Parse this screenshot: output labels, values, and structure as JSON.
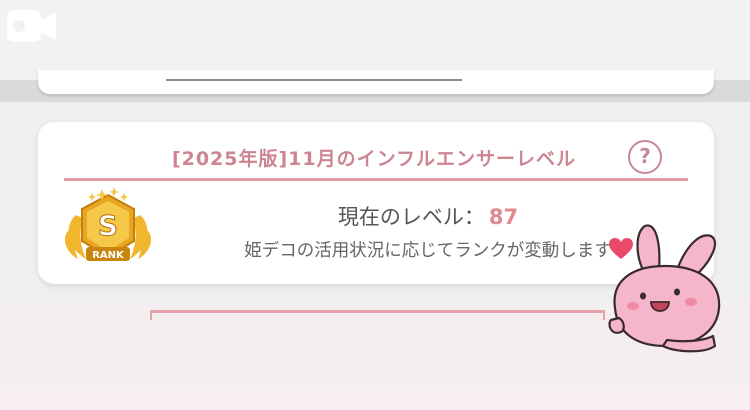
{
  "status_bar": {
    "record_icon": "video-camera-icon"
  },
  "influencer_card": {
    "title": "[2025年版]11月のインフルエンサーレベル",
    "help_symbol": "?",
    "rank_badge": {
      "letter": "S",
      "label": "RANK",
      "color": "#e8a520"
    },
    "level_label": "現在のレベル：",
    "level_value": "87",
    "description": "姫デコの活用状況に応じてランクが変動します"
  },
  "colors": {
    "title_pink": "#cc8591",
    "rule_pink": "#e49aa4",
    "level_value": "#e0878f",
    "sticker_pink": "#f5b6cc"
  },
  "overlays": {
    "sticker": "pink-rabbit-sticker",
    "heart": "heart-icon"
  }
}
